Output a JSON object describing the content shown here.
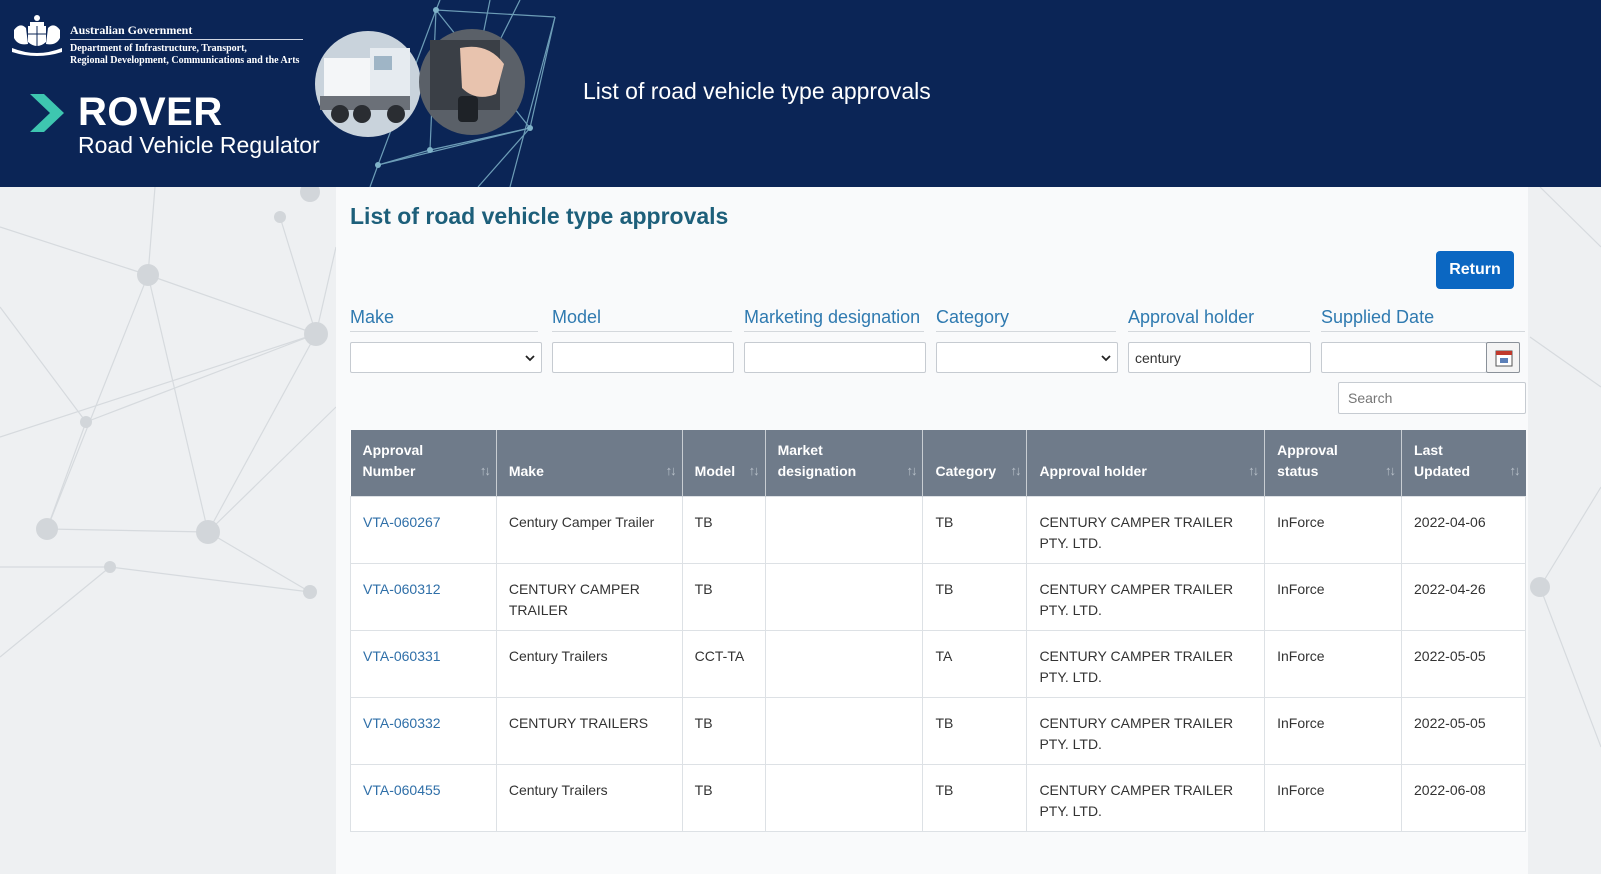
{
  "header": {
    "gov_title": "Australian Government",
    "gov_dept_line1": "Department of Infrastructure, Transport,",
    "gov_dept_line2": "Regional Development, Communications and the Arts",
    "brand_name": "ROVER",
    "brand_tagline": "Road Vehicle Regulator",
    "title": "List of road vehicle type approvals"
  },
  "page": {
    "title": "List of road vehicle type approvals",
    "return_label": "Return"
  },
  "filters": {
    "make_label": "Make",
    "model_label": "Model",
    "marketing_label": "Marketing designation",
    "category_label": "Category",
    "holder_label": "Approval holder",
    "supplied_label": "Supplied Date",
    "holder_value": "century",
    "search_placeholder": "Search"
  },
  "table": {
    "columns": [
      {
        "line1": "Approval",
        "line2": "Number"
      },
      {
        "line1": "",
        "line2": "Make"
      },
      {
        "line1": "",
        "line2": "Model"
      },
      {
        "line1": "Market",
        "line2": "designation"
      },
      {
        "line1": "",
        "line2": "Category"
      },
      {
        "line1": "",
        "line2": "Approval holder"
      },
      {
        "line1": "Approval",
        "line2": "status"
      },
      {
        "line1": "Last",
        "line2": "Updated"
      }
    ],
    "sort_glyph": "↑↓",
    "rows": [
      {
        "number": "VTA-060267",
        "make": "Century Camper Trailer",
        "model": "TB",
        "designation": "",
        "category": "TB",
        "holder": "CENTURY CAMPER TRAILER PTY. LTD.",
        "status": "InForce",
        "updated": "2022-04-06"
      },
      {
        "number": "VTA-060312",
        "make": "CENTURY CAMPER TRAILER",
        "model": "TB",
        "designation": "",
        "category": "TB",
        "holder": "CENTURY CAMPER TRAILER PTY. LTD.",
        "status": "InForce",
        "updated": "2022-04-26"
      },
      {
        "number": "VTA-060331",
        "make": "Century Trailers",
        "model": "CCT-TA",
        "designation": "",
        "category": "TA",
        "holder": "CENTURY CAMPER TRAILER PTY. LTD.",
        "status": "InForce",
        "updated": "2022-05-05"
      },
      {
        "number": "VTA-060332",
        "make": "CENTURY TRAILERS",
        "model": "TB",
        "designation": "",
        "category": "TB",
        "holder": "CENTURY CAMPER TRAILER PTY. LTD.",
        "status": "InForce",
        "updated": "2022-05-05"
      },
      {
        "number": "VTA-060455",
        "make": "Century Trailers",
        "model": "TB",
        "designation": "",
        "category": "TB",
        "holder": "CENTURY CAMPER TRAILER PTY. LTD.",
        "status": "InForce",
        "updated": "2022-06-08"
      }
    ]
  },
  "colors": {
    "header_bg": "#0b2556",
    "accent_teal": "#3ec6b0",
    "title_teal": "#1d5f7a",
    "label_blue": "#2f7ab0",
    "button_blue": "#0b67c2",
    "table_header": "#6f7b8a",
    "link_blue": "#2f6fa8"
  }
}
